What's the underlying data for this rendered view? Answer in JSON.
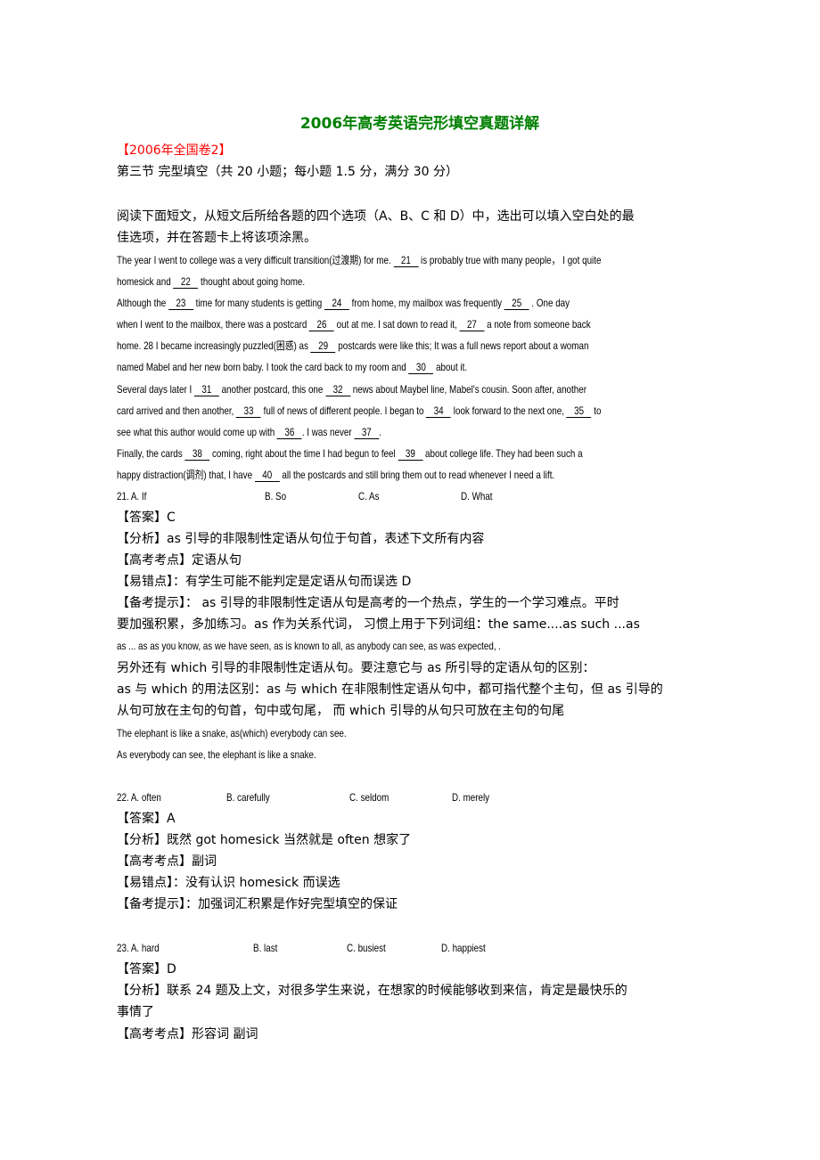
{
  "title": "2006年高考英语完形填空真题详解",
  "section_tag": "【2006年全国卷2】",
  "section_heading": "第三节  完型填空（共 20 小题；每小题 1.5 分，满分 30 分）",
  "instructions": [
    "  阅读下面短文，从短文后所给各题的四个选项（A、B、C 和 D）中，选出可以填入空白处的最",
    "佳选项，并在答题卡上将该项涂黑。"
  ],
  "passage": [
    "The year I went to college was a very difficult transition(过渡期) for me. __21__  is probably true with many people，  I got quite",
    "homesick and  __22__ thought about going home.",
    "Although the  __23__  time for many students is getting  __24__  from home, my mailbox was frequently  __25__ . One day",
    "when I went to the mailbox, there was a postcard  __26__  out at me. I sat down to read it,  __27__  a note from someone back",
    "home. 28 I became increasingly puzzled(困惑) as  __29__  postcards were like this; It was a full news report about a woman",
    "named Mabel and her new born baby. I took the card back to my room and  __30__  about it.",
    "Several days later I  __31__  another postcard, this one  __32__ news about Maybel line, Mabel's cousin. Soon after, another",
    "card arrived and then another, __33__  full of news of different people. I began to  __34__ look forward to the next one,  __35__ to",
    "see what this author would come up with  __36__. I was never  __37__.",
    "Finally, the cards  __38__ coming, right about the time I had begun to feel  __39__  about college life. They had been such a",
    "happy distraction(调剂) that, I have  __40__  all the postcards and still bring them out to read whenever I need a lift."
  ],
  "questions": [
    {
      "options": [
        "21. A. If",
        "B. So",
        "C. As",
        "D. What"
      ],
      "answer": "【答案】C",
      "analysis": "【分析】as 引导的非限制性定语从句位于句首，表述下文所有内容",
      "point": "【高考考点】定语从句",
      "mistake": "【易错点】：有学生可能不能判定是定语从句而误选 D",
      "tips": [
        "【备考提示】：   as 引导的非限制性定语从句是高考的一个热点，学生的一个学习难点。平时",
        "要加强积累，多加练习。as  作为关系代词，  习惯上用于下列词组：the same....as      such ...as",
        "as ... as    as you know,      as we have seen,    as is known to all,      as anybody can see,     as was expected, .",
        "另外还有 which 引导的非限制性定语从句。要注意它与 as 所引导的定语从句的区别：",
        "as 与 which 的用法区别：as 与  which 在非限制性定语从句中，都可指代整个主句，但 as 引导的",
        "从句可放在主句的句首，句中或句尾，   而  which 引导的从句只可放在主句的句尾",
        "    The elephant is like a snake, as(which) everybody can see.",
        "    As everybody can see, the elephant is like a snake."
      ]
    },
    {
      "options": [
        "22. A. often",
        "B. carefully",
        "C. seldom",
        "D. merely"
      ],
      "answer": "【答案】A",
      "analysis": "【分析】既然 got homesick  当然就是 often 想家了",
      "point": "【高考考点】副词",
      "mistake": "【易错点】：没有认识 homesick 而误选",
      "tips": [
        "【备考提示】：加强词汇积累是作好完型填空的保证"
      ]
    },
    {
      "options": [
        "23. A. hard",
        "B. last",
        "C. busiest",
        "D. happiest"
      ],
      "answer": "【答案】D",
      "analysis": "【分析】联系 24 题及上文，对很多学生来说，在想家的时候能够收到来信，肯定是最快乐的",
      "analysis_cont": "事情了",
      "point": "【高考考点】形容词  副词"
    }
  ]
}
